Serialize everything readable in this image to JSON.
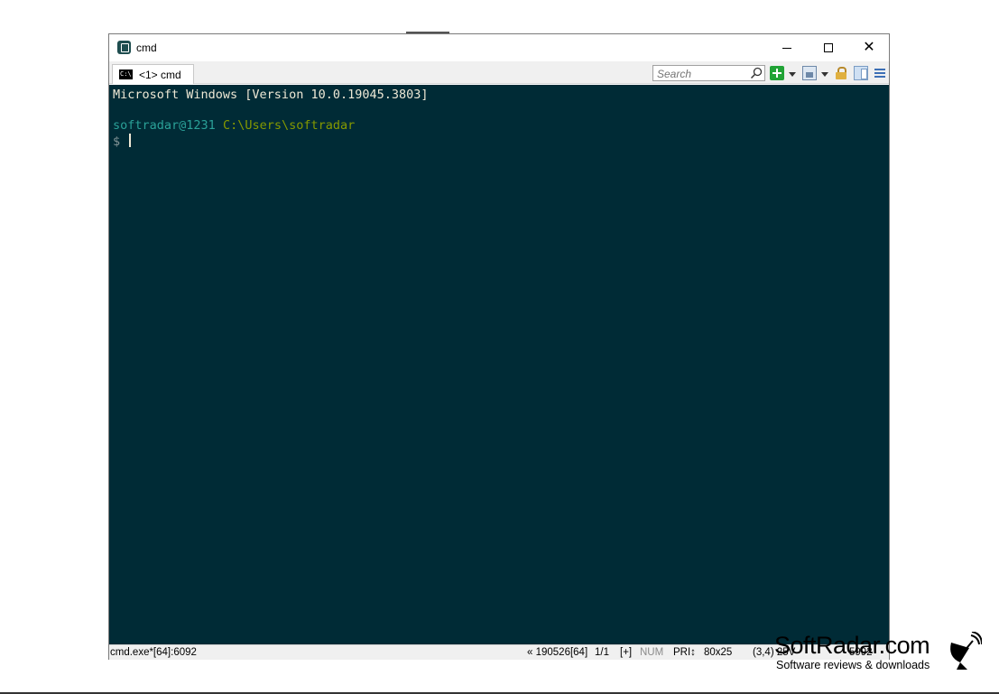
{
  "window": {
    "title": "cmd"
  },
  "tabs": [
    {
      "label": "<1> cmd"
    }
  ],
  "toolbar": {
    "search_placeholder": "Search"
  },
  "console": {
    "lines": [
      {
        "text": "Microsoft Windows [Version 10.0.19045.3803]"
      },
      {
        "text": ""
      },
      {
        "user_host": "softradar@1231",
        "path": "C:\\Users\\softradar"
      },
      {
        "prompt": "$"
      }
    ]
  },
  "statusbar": {
    "process": "cmd.exe*[64]:6092",
    "pid_info": "« 190526[64]",
    "page": "1/1",
    "plus": "[+]",
    "num": "NUM",
    "priority": "PRI↕",
    "size": "80x25",
    "cursor_pos": "(3,4) 25V",
    "extra": "5992"
  },
  "watermark": {
    "title": "SoftRadar.com",
    "subtitle": "Software reviews & downloads"
  },
  "colors": {
    "console_bg": "#002b36",
    "text_white": "#eee8d5",
    "text_teal": "#2aa198",
    "text_green": "#859900"
  }
}
